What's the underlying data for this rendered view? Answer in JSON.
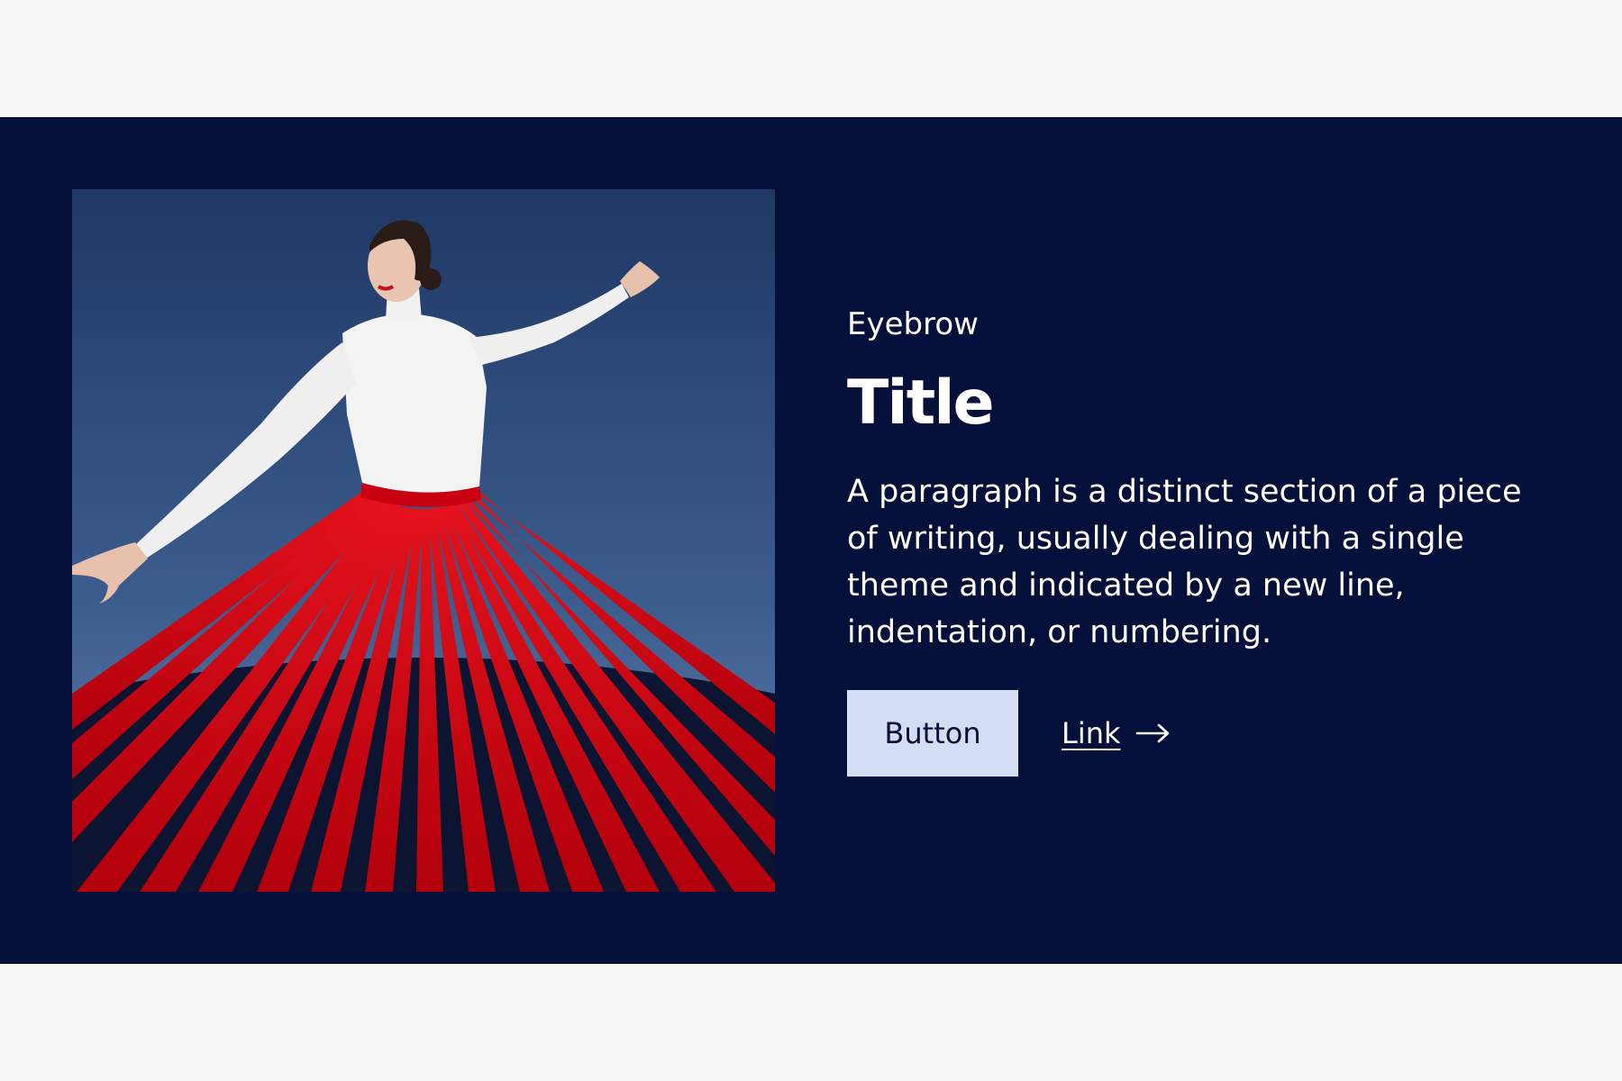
{
  "hero": {
    "image": {
      "icon": "dancer-photo",
      "colors": {
        "sky_top": "#213a68",
        "sky_bottom": "#5f7fae",
        "skirt": "#d50a16",
        "top": "#f4f4f4"
      }
    },
    "eyebrow": "Eyebrow",
    "title": "Title",
    "paragraph": "A paragraph is a distinct section of a piece of writing, usually dealing with a single theme and indicated by a new line, indentation, or numbering.",
    "button_label": "Button",
    "link_label": "Link",
    "link_icon": "arrow-right-icon"
  },
  "colors": {
    "page_background": "#f6f6f6",
    "band_background": "#040f3a",
    "button_background": "#d3def4",
    "text": "#ffffff"
  }
}
